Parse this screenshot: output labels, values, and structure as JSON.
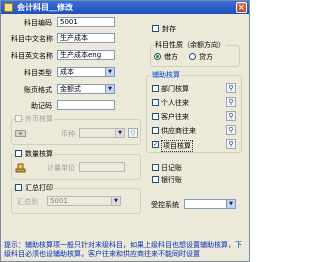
{
  "window": {
    "title": "会计科目＿修改",
    "close": "×"
  },
  "form": {
    "code_label": "科目编码",
    "code_value": "5001",
    "cn_name_label": "科目中文名称",
    "cn_name_value": "生产成本",
    "en_name_label": "科目英文名称",
    "en_name_value": "生产成本eng",
    "type_label": "科目类型",
    "type_value": "成本",
    "format_label": "账页格式",
    "format_value": "金额式",
    "mnemonic_label": "助记码",
    "mnemonic_value": ""
  },
  "seal_label": "封存",
  "nature": {
    "legend": "科目性质（余额方向）",
    "debit": "借方",
    "credit": "贷方"
  },
  "aux": {
    "legend": "辅助核算",
    "items": [
      {
        "label": "部门核算",
        "checked": false
      },
      {
        "label": "个人往来",
        "checked": false
      },
      {
        "label": "客户往来",
        "checked": false
      },
      {
        "label": "供应商往来",
        "checked": false
      },
      {
        "label": "项目核算",
        "checked": true
      }
    ]
  },
  "foreign": {
    "legend": "外币核算",
    "currency_label": "币种",
    "currency_value": ""
  },
  "quantity": {
    "legend": "数量核算",
    "unit_label": "计量单位",
    "unit_value": ""
  },
  "summary": {
    "legend": "汇总打印",
    "target_label": "汇总到",
    "target_value": "5001"
  },
  "journal": {
    "daily_label": "日记账",
    "bank_label": "银行账"
  },
  "control": {
    "label": "受控系统",
    "value": ""
  },
  "hint": "提示：辅助核算项一般只针对末级科目，如果上级科目也想设置辅助核算，下级科目必须也设辅助核算，客户往来和供应商往来不能同时设置"
}
